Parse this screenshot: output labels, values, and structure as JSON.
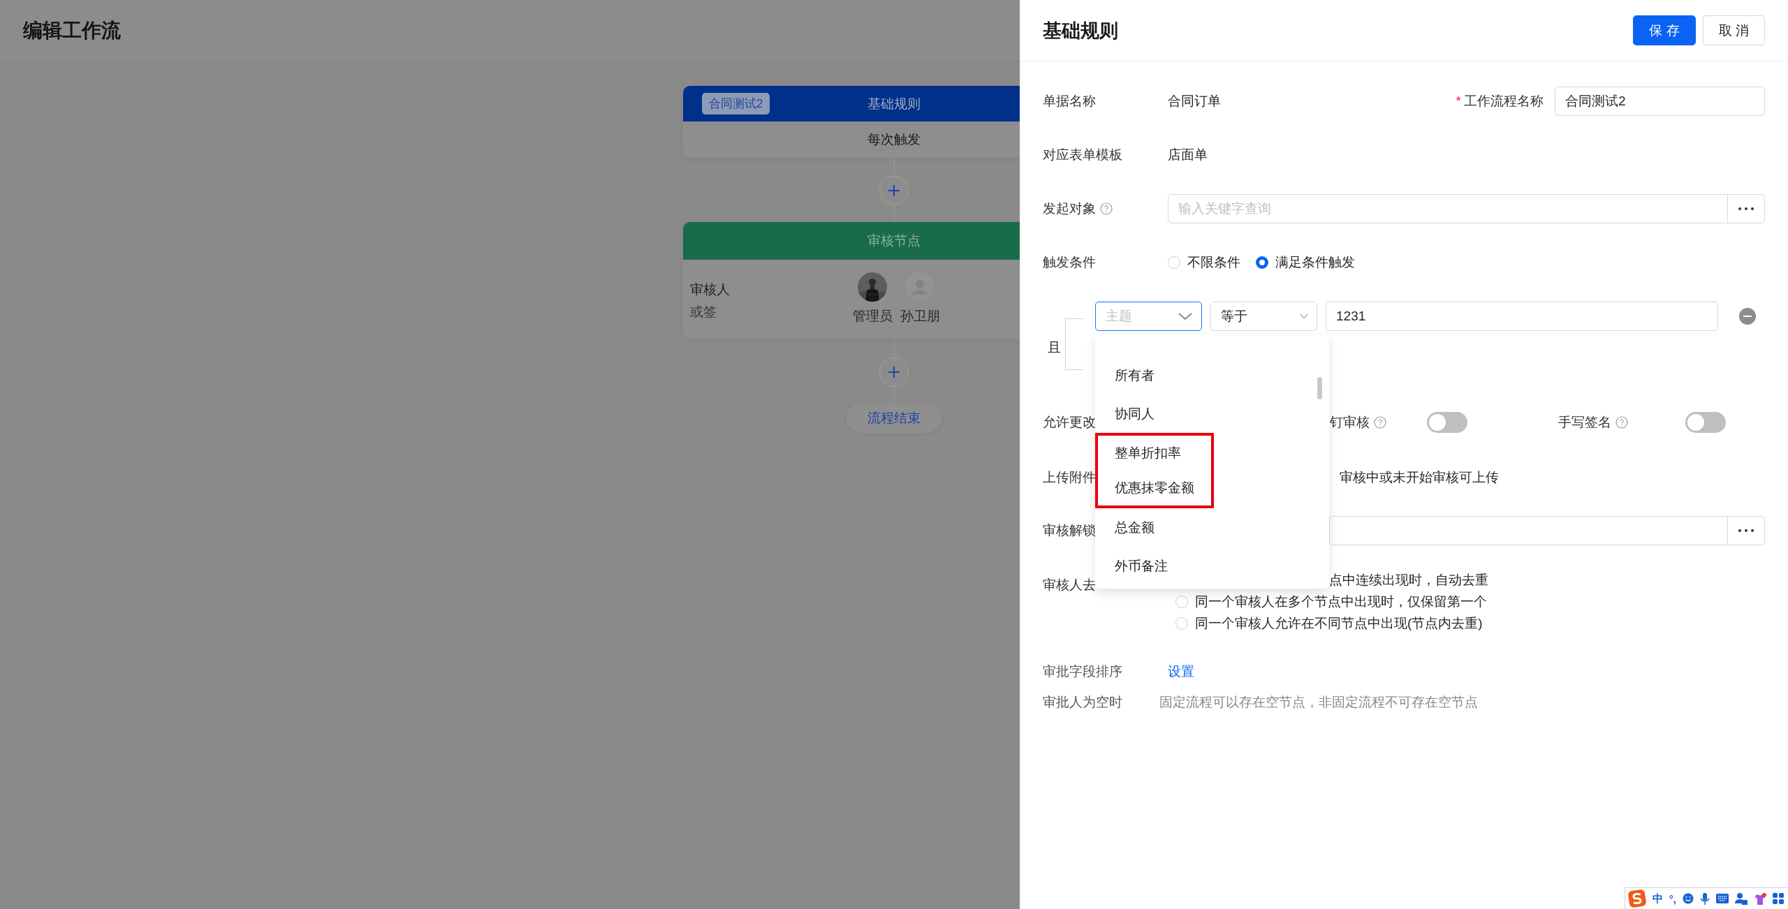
{
  "page": {
    "title": "编辑工作流"
  },
  "flow": {
    "start": {
      "tag": "合同测试2",
      "title": "基础规则",
      "trigger": "每次触发"
    },
    "approval": {
      "title": "审核节点",
      "role": "审核人",
      "mode": "或签",
      "approvers": [
        {
          "name": "管理员"
        },
        {
          "name": "孙卫朋",
          "kind": "placeholder"
        }
      ]
    },
    "end": "流程结束"
  },
  "drawer": {
    "title": "基础规则",
    "buttons": [
      {
        "label": "保 存",
        "kind": "primary"
      },
      {
        "label": "取 消",
        "kind": "default"
      }
    ],
    "document": {
      "label": "单据名称",
      "value": "合同订单"
    },
    "workflow_name": {
      "label": "工作流程名称",
      "required_mark": "*",
      "value": "合同测试2"
    },
    "template": {
      "label": "对应表单模板",
      "value": "店面单"
    },
    "initiator": {
      "label": "发起对象",
      "placeholder": "输入关键字查询"
    },
    "trigger": {
      "label": "触发条件",
      "options": [
        {
          "label": "不限条件",
          "selected": false
        },
        {
          "label": "满足条件触发",
          "selected": true
        }
      ]
    },
    "condition": {
      "connector": "且",
      "field": {
        "placeholder": "主题",
        "focused": true
      },
      "operator": "等于",
      "value": "1231"
    },
    "dropdown": {
      "items": [
        {
          "label": "所有者",
          "marked": false
        },
        {
          "label": "协同人",
          "marked": false
        },
        {
          "label": "整单折扣率",
          "marked": true
        },
        {
          "label": "优惠抹零金额",
          "marked": true
        },
        {
          "label": "总金额",
          "marked": false
        },
        {
          "label": "外币备注",
          "marked": false
        }
      ]
    },
    "allow_change": {
      "label": "允许更改"
    },
    "dingtalk": {
      "label": "钉审核",
      "on": false
    },
    "signature": {
      "label": "手写签名",
      "on": false
    },
    "upload": {
      "label": "上传附件",
      "option": "审核中或未开始审核可上传"
    },
    "unlock": {
      "label": "审核解锁"
    },
    "dedupe": {
      "label": "审核人去",
      "first_option": "点中连续出现时，自动去重",
      "options": [
        {
          "label": "同一个审核人在多个节点中出现时，仅保留第一个",
          "selected": false
        },
        {
          "label": "同一个审核人允许在不同节点中出现(节点内去重)",
          "selected": false
        }
      ]
    },
    "field_order": {
      "label": "审批字段排序",
      "link": "设置"
    },
    "empty_approver": {
      "label": "审批人为空时",
      "value": "固定流程可以存在空节点，非固定流程不可存在空节点"
    }
  },
  "ime_bar": {
    "texts": [
      "中",
      "°,"
    ]
  }
}
